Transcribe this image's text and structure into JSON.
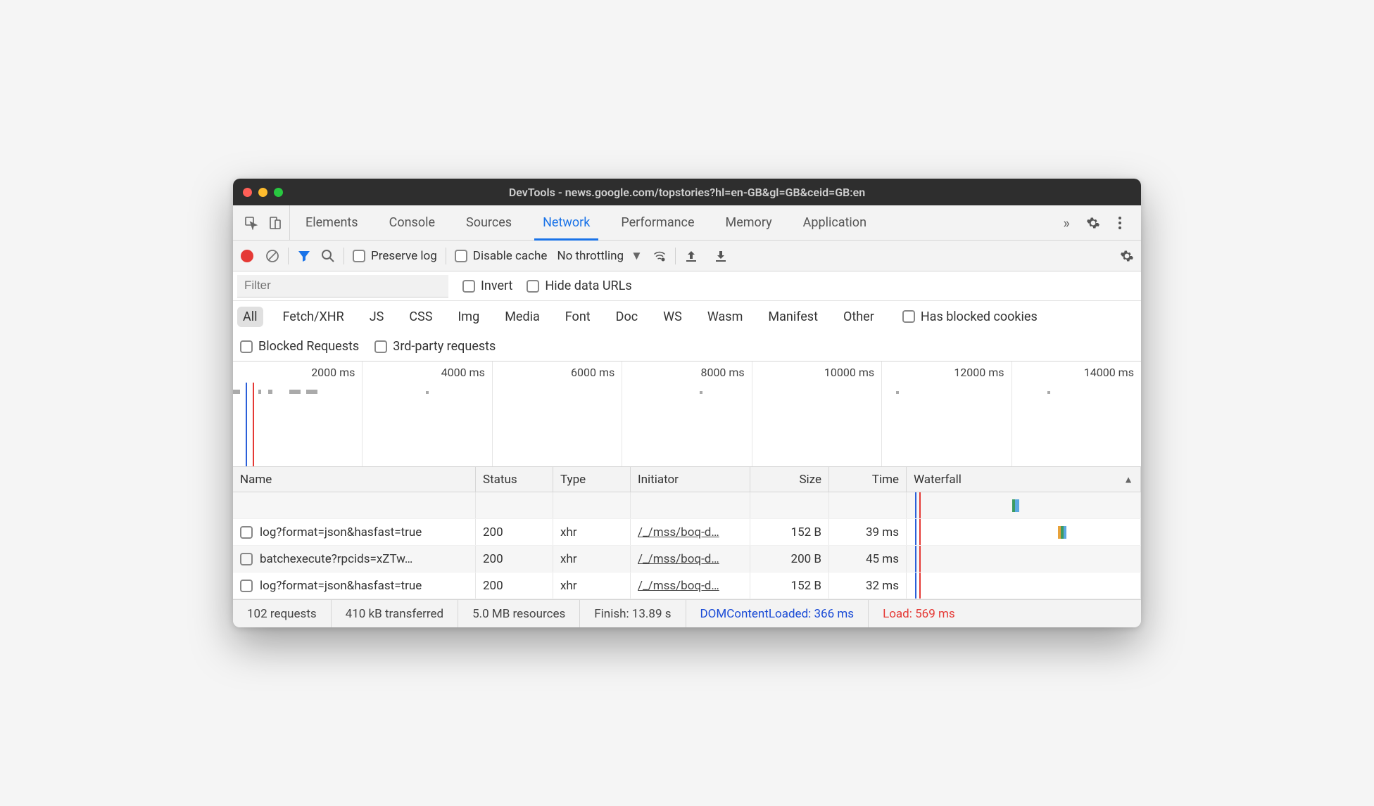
{
  "window": {
    "title": "DevTools - news.google.com/topstories?hl=en-GB&gl=GB&ceid=GB:en"
  },
  "tabs": {
    "items": [
      "Elements",
      "Console",
      "Sources",
      "Network",
      "Performance",
      "Memory",
      "Application"
    ],
    "active_index": 3
  },
  "toolbar": {
    "preserve_log": "Preserve log",
    "disable_cache": "Disable cache",
    "throttling": "No throttling"
  },
  "filter": {
    "placeholder": "Filter",
    "invert": "Invert",
    "hide_data_urls": "Hide data URLs"
  },
  "types": [
    "All",
    "Fetch/XHR",
    "JS",
    "CSS",
    "Img",
    "Media",
    "Font",
    "Doc",
    "WS",
    "Wasm",
    "Manifest",
    "Other"
  ],
  "types_active_index": 0,
  "type_options": {
    "has_blocked_cookies": "Has blocked cookies",
    "blocked_requests": "Blocked Requests",
    "third_party": "3rd-party requests"
  },
  "timeline": {
    "ticks": [
      "2000 ms",
      "4000 ms",
      "6000 ms",
      "8000 ms",
      "10000 ms",
      "12000 ms",
      "14000 ms"
    ]
  },
  "columns": {
    "name": "Name",
    "status": "Status",
    "type": "Type",
    "initiator": "Initiator",
    "size": "Size",
    "time": "Time",
    "waterfall": "Waterfall"
  },
  "rows": [
    {
      "name": "log?format=json&hasfast=true",
      "status": "200",
      "type": "xhr",
      "initiator": "/_/mss/boq-d…",
      "size": "152 B",
      "time": "39 ms"
    },
    {
      "name": "batchexecute?rpcids=xZTw…",
      "status": "200",
      "type": "xhr",
      "initiator": "/_/mss/boq-d…",
      "size": "200 B",
      "time": "45 ms"
    },
    {
      "name": "log?format=json&hasfast=true",
      "status": "200",
      "type": "xhr",
      "initiator": "/_/mss/boq-d…",
      "size": "152 B",
      "time": "32 ms"
    }
  ],
  "status": {
    "requests": "102 requests",
    "transferred": "410 kB transferred",
    "resources": "5.0 MB resources",
    "finish": "Finish: 13.89 s",
    "dcl": "DOMContentLoaded: 366 ms",
    "load": "Load: 569 ms"
  }
}
